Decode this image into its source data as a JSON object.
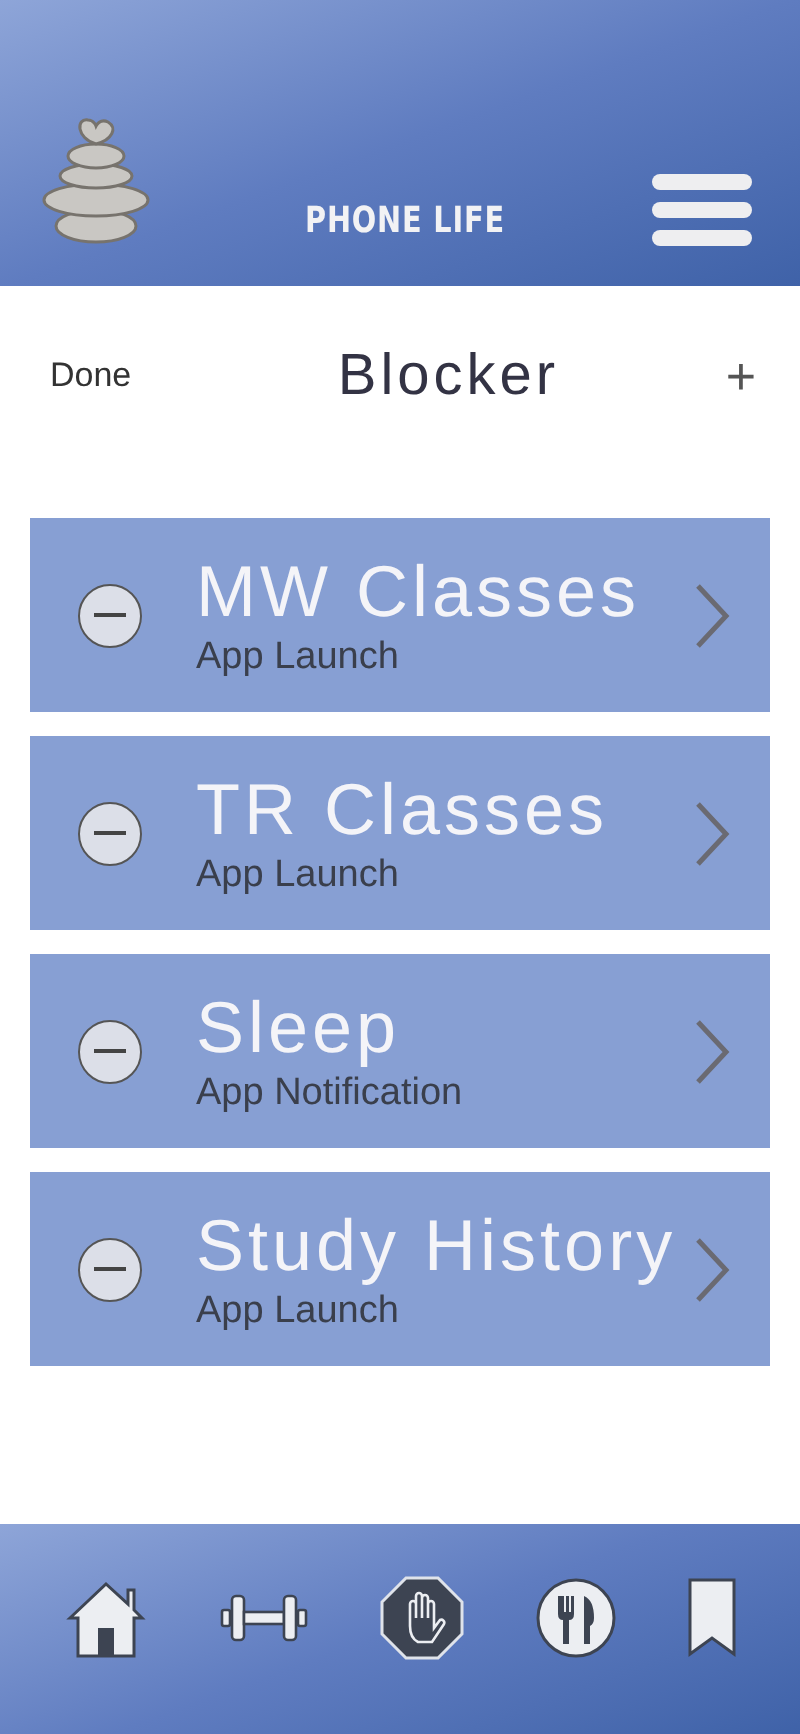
{
  "header": {
    "title": "PHONE LIFE"
  },
  "nav": {
    "left": "Done",
    "title": "Blocker",
    "right": "+"
  },
  "items": [
    {
      "title": "MW Classes",
      "subtitle": "App Launch"
    },
    {
      "title": "TR Classes",
      "subtitle": "App Launch"
    },
    {
      "title": "Sleep",
      "subtitle": "App Notification"
    },
    {
      "title": "Study History",
      "subtitle": "App Launch"
    }
  ],
  "tabs": [
    {
      "kind": "home",
      "selected": false
    },
    {
      "kind": "fitness",
      "selected": false
    },
    {
      "kind": "blocker",
      "selected": true
    },
    {
      "kind": "food",
      "selected": false
    },
    {
      "kind": "bookmark",
      "selected": false
    }
  ]
}
